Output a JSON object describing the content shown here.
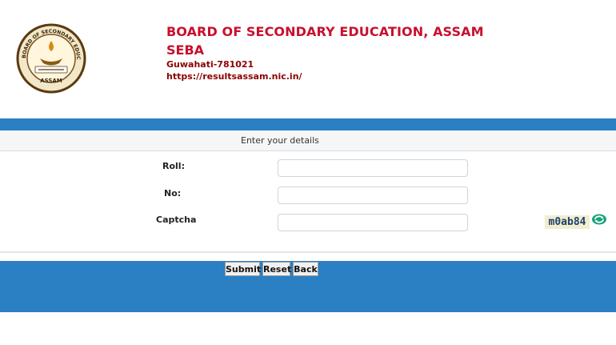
{
  "header": {
    "logo_text": "BOARD OF SECONDARY EDUCATION ASSAM",
    "title": "BOARD OF SECONDARY EDUCATION, ASSAM",
    "subtitle": "SEBA",
    "address": "Guwahati-781021",
    "url": "https://resultsassam.nic.in/"
  },
  "form": {
    "heading": "Enter your details",
    "roll_label": "Roll:",
    "no_label": "No:",
    "captcha_label": "Captcha",
    "roll_value": "",
    "no_value": "",
    "captcha_value": "",
    "captcha_code": "m0ab84"
  },
  "buttons": {
    "submit": "Submit",
    "reset": "Reset",
    "back": "Back"
  },
  "colors": {
    "accent_blue": "#2b7fc3",
    "title_red": "#c8102e",
    "refresh_green": "#1aa37a"
  },
  "icons": {
    "refresh": "refresh-icon"
  }
}
